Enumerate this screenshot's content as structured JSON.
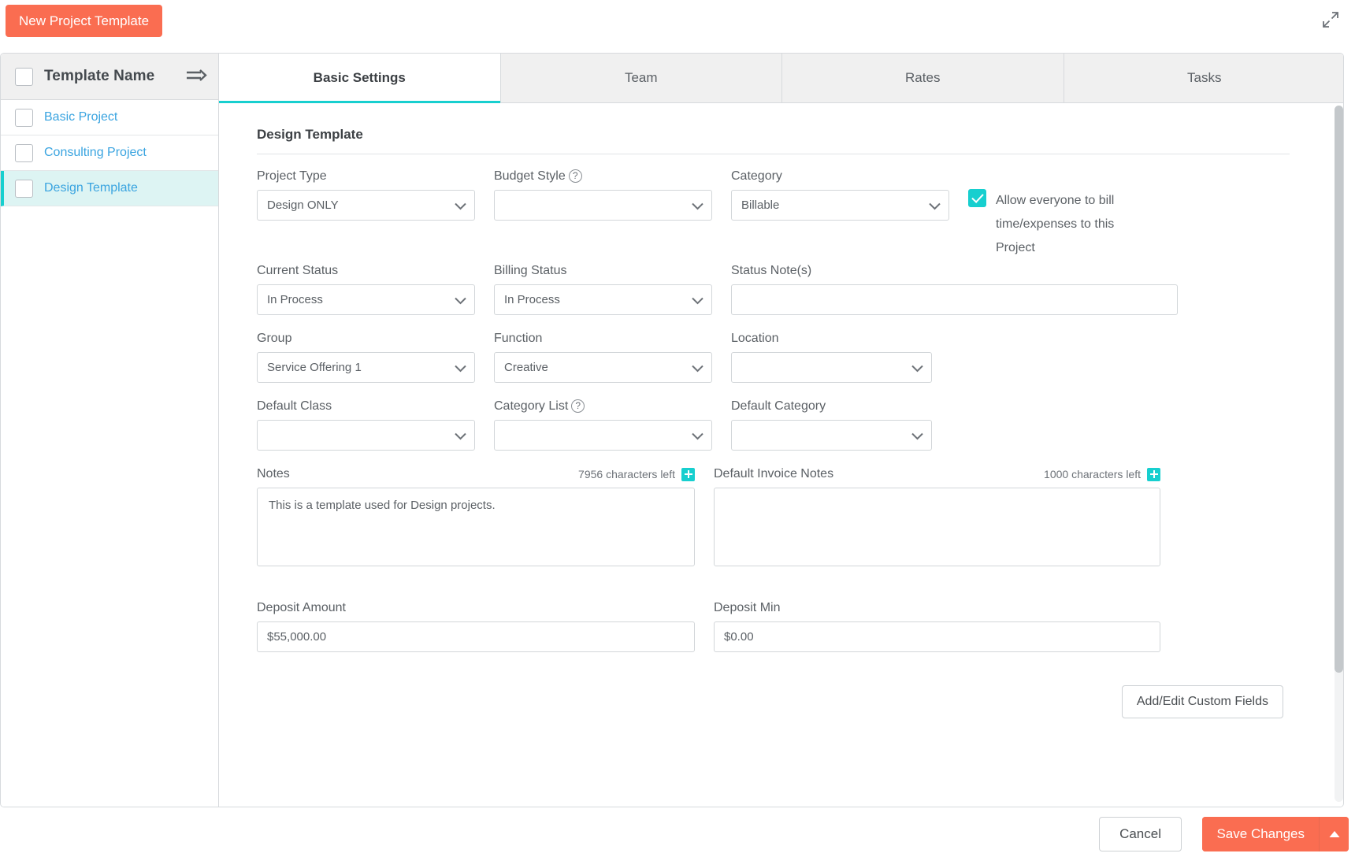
{
  "topbar": {
    "new_template_label": "New Project Template",
    "expand_icon": "expand-arrows-icon"
  },
  "sidebar": {
    "header": {
      "title": "Template Name",
      "collapse_icon": "collapse-list-icon"
    },
    "items": [
      {
        "label": "Basic Project",
        "checked": false,
        "active": false
      },
      {
        "label": "Consulting Project",
        "checked": false,
        "active": false
      },
      {
        "label": "Design Template",
        "checked": false,
        "active": true
      }
    ]
  },
  "tabs": [
    {
      "label": "Basic Settings",
      "active": true
    },
    {
      "label": "Team",
      "active": false
    },
    {
      "label": "Rates",
      "active": false
    },
    {
      "label": "Tasks",
      "active": false
    }
  ],
  "form": {
    "section_title": "Design Template",
    "fields": {
      "project_type": {
        "label": "Project Type",
        "value": "Design ONLY"
      },
      "budget_style": {
        "label": "Budget Style",
        "value": "",
        "has_help": true
      },
      "category": {
        "label": "Category",
        "value": "Billable"
      },
      "allow_bill": {
        "label": "Allow everyone to bill time/expenses to this Project",
        "checked": true
      },
      "current_status": {
        "label": "Current Status",
        "value": "In Process"
      },
      "billing_status": {
        "label": "Billing Status",
        "value": "In Process"
      },
      "status_notes": {
        "label": "Status Note(s)",
        "value": ""
      },
      "group": {
        "label": "Group",
        "value": "Service Offering 1"
      },
      "function": {
        "label": "Function",
        "value": "Creative"
      },
      "location": {
        "label": "Location",
        "value": ""
      },
      "default_class": {
        "label": "Default Class",
        "value": ""
      },
      "category_list": {
        "label": "Category List",
        "value": "",
        "has_help": true
      },
      "default_category": {
        "label": "Default Category",
        "value": ""
      },
      "notes": {
        "label": "Notes",
        "value": "This is a template used for Design projects.",
        "chars_left": "7956 characters left"
      },
      "default_invoice_notes": {
        "label": "Default Invoice Notes",
        "value": "",
        "chars_left": "1000 characters left"
      },
      "deposit_amount": {
        "label": "Deposit Amount",
        "value": "$55,000.00"
      },
      "deposit_min": {
        "label": "Deposit Min",
        "value": "$0.00"
      }
    },
    "custom_fields_label": "Add/Edit Custom Fields"
  },
  "footer": {
    "cancel_label": "Cancel",
    "save_label": "Save Changes",
    "save_caret_icon": "caret-up-icon"
  },
  "colors": {
    "accent_orange": "#fa6d51",
    "accent_teal": "#17cfcf",
    "link_blue": "#3aa4e0",
    "active_row_bg": "#ddf4f3"
  }
}
